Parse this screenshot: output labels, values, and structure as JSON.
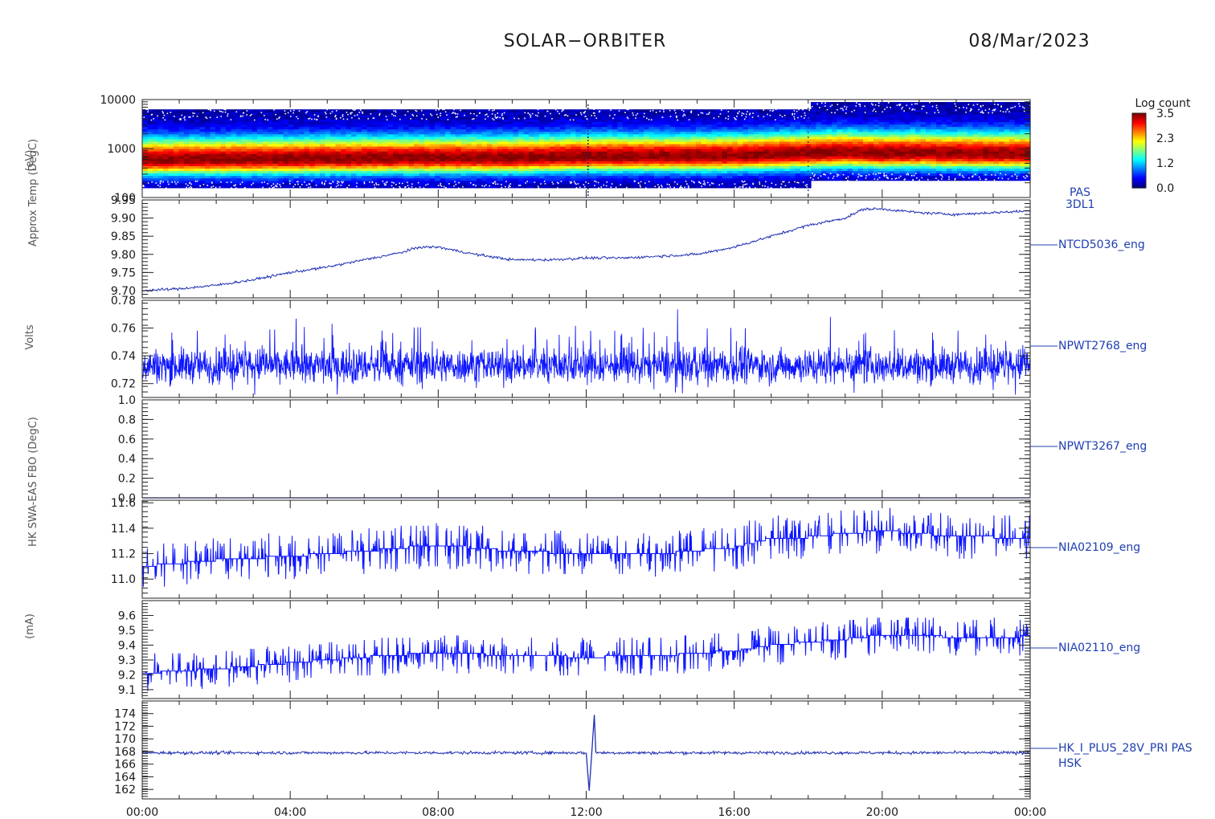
{
  "header": {
    "title": "SOLAR−ORBITER",
    "date": "08/Mar/2023"
  },
  "colorbar": {
    "title": "Log count",
    "ticks": [
      "3.5",
      "2.3",
      "1.2",
      "0.0"
    ]
  },
  "y_axis_labels_overlapping": [
    "(eV)",
    "Approx Temp (DegC)",
    "Volts",
    "HK SWA-EAS FBO (DegC)",
    "(mA)"
  ],
  "chart_data": [
    {
      "type": "heatmap",
      "panel_tag": [
        "PAS",
        "3DL1"
      ],
      "ylabel": "(eV)",
      "yscale": "log",
      "ylim": [
        100,
        10000
      ],
      "y_ticks": [
        "10000",
        "1000",
        "100"
      ],
      "colorscale": "log count 0.0 to 3.5",
      "peak_energy_ev": {
        "x_hours": [
          0,
          2,
          4,
          6,
          8,
          10,
          12,
          14,
          16,
          17,
          18,
          19,
          20,
          21,
          22,
          24
        ],
        "values": [
          600,
          610,
          620,
          640,
          650,
          650,
          700,
          700,
          720,
          760,
          800,
          850,
          800,
          820,
          800,
          790
        ]
      }
    },
    {
      "type": "line",
      "series": [
        {
          "name": "NTCD5036_eng"
        }
      ],
      "ylim": [
        9.68,
        9.95
      ],
      "y_ticks": [
        "9.95",
        "9.90",
        "9.85",
        "9.80",
        "9.75",
        "9.70"
      ],
      "x_hours": [
        0,
        1,
        2,
        3,
        4,
        5,
        6,
        7,
        7.5,
        8,
        9,
        10,
        11,
        12,
        13,
        14,
        15,
        16,
        17,
        18,
        19,
        19.5,
        20,
        21,
        22,
        23,
        24
      ],
      "values": [
        9.7,
        9.705,
        9.715,
        9.73,
        9.75,
        9.765,
        9.785,
        9.805,
        9.82,
        9.82,
        9.8,
        9.785,
        9.785,
        9.79,
        9.79,
        9.795,
        9.8,
        9.82,
        9.85,
        9.88,
        9.9,
        9.925,
        9.925,
        9.915,
        9.91,
        9.915,
        9.92
      ]
    },
    {
      "type": "line",
      "series": [
        {
          "name": "NPWT2768_eng"
        }
      ],
      "ylim": [
        0.71,
        0.78
      ],
      "y_ticks": [
        "0.78",
        "0.76",
        "0.74",
        "0.72"
      ],
      "baseline": 0.733,
      "noise_range": [
        0.712,
        0.775
      ]
    },
    {
      "type": "line",
      "series": [
        {
          "name": "NPWT3267_eng"
        }
      ],
      "ylim": [
        0.0,
        1.0
      ],
      "y_ticks": [
        "1.0",
        "0.8",
        "0.6",
        "0.4",
        "0.2",
        "0.0"
      ],
      "baseline": 0.0
    },
    {
      "type": "line",
      "series": [
        {
          "name": "NIA02109_eng"
        }
      ],
      "ylim": [
        10.85,
        11.62
      ],
      "y_ticks": [
        "11.6",
        "11.4",
        "11.2",
        "11.0"
      ],
      "x_hours": [
        0,
        2,
        4,
        6,
        8,
        10,
        12,
        14,
        16,
        17,
        18,
        19,
        20,
        21,
        22,
        23,
        24
      ],
      "values": [
        11.1,
        11.15,
        11.18,
        11.22,
        11.27,
        11.22,
        11.2,
        11.2,
        11.25,
        11.32,
        11.33,
        11.36,
        11.38,
        11.36,
        11.33,
        11.33,
        11.32
      ]
    },
    {
      "type": "line",
      "series": [
        {
          "name": "NIA02110_eng"
        }
      ],
      "ylim": [
        9.04,
        9.7
      ],
      "y_ticks": [
        "9.6",
        "9.5",
        "9.4",
        "9.3",
        "9.2",
        "9.1"
      ],
      "x_hours": [
        0,
        2,
        4,
        6,
        8,
        10,
        12,
        14,
        16,
        17,
        18,
        19,
        20,
        21,
        22,
        23,
        24
      ],
      "values": [
        9.21,
        9.24,
        9.28,
        9.32,
        9.35,
        9.33,
        9.32,
        9.33,
        9.36,
        9.4,
        9.42,
        9.44,
        9.47,
        9.47,
        9.45,
        9.45,
        9.46
      ]
    },
    {
      "type": "line",
      "series": [
        {
          "name": "HK_I_PLUS_28V_PRI PAS"
        }
      ],
      "panel_tag_extra": "HSK",
      "ylim": [
        160.5,
        176
      ],
      "y_ticks": [
        "174",
        "172",
        "170",
        "168",
        "166",
        "164",
        "162"
      ],
      "baseline": 167.8,
      "spike": {
        "x_hours": 12.1,
        "min": 161.8,
        "max": 173.8
      }
    }
  ],
  "x_axis": {
    "ticks": [
      "00:00",
      "04:00",
      "08:00",
      "12:00",
      "16:00",
      "20:00",
      "00:00"
    ],
    "range_hours": [
      0,
      24
    ]
  }
}
